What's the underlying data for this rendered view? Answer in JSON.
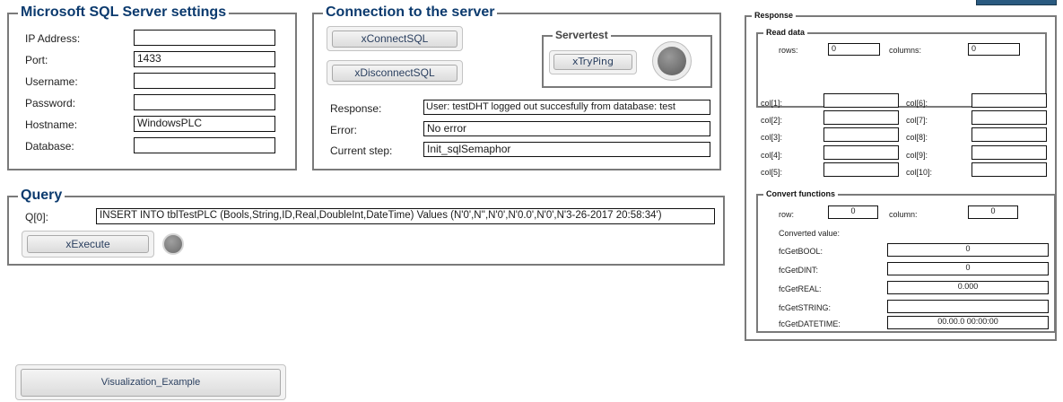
{
  "sql_settings": {
    "title": "Microsoft SQL Server settings",
    "fields": [
      {
        "label": "IP Address:",
        "value": ""
      },
      {
        "label": "Port:",
        "value": "1433"
      },
      {
        "label": "Username:",
        "value": ""
      },
      {
        "label": "Password:",
        "value": ""
      },
      {
        "label": "Hostname:",
        "value": "WindowsPLC"
      },
      {
        "label": "Database:",
        "value": ""
      }
    ]
  },
  "connection": {
    "title": "Connection to the server",
    "connect_label": "xConnectSQL",
    "disconnect_label": "xDisconnectSQL",
    "servertest": {
      "title": "Servertest",
      "ping_label": "xTryPing",
      "lamp_color": "#6e6e6e"
    },
    "response_label": "Response:",
    "response_value": "User: testDHT  logged out succesfully from database: test",
    "error_label": "Error:",
    "error_value": "No error",
    "step_label": "Current step:",
    "step_value": "Init_sqlSemaphor"
  },
  "query": {
    "title": "Query",
    "q_label": "Q[0]:",
    "q_value": "INSERT INTO tblTestPLC (Bools,String,ID,Real,DoubleInt,DateTime) Values (N'0',N'',N'0',N'0.0',N'0',N'3-26-2017 20:58:34')",
    "execute_label": "xExecute",
    "lamp_color": "#7a7a7a"
  },
  "response": {
    "title": "Response",
    "read_data": {
      "title": "Read data",
      "rows_label": "rows:",
      "rows_value": "0",
      "columns_label": "columns:",
      "columns_value": "0"
    },
    "cols_left": [
      {
        "label": "col[1]:",
        "value": ""
      },
      {
        "label": "col[2]:",
        "value": ""
      },
      {
        "label": "col[3]:",
        "value": ""
      },
      {
        "label": "col[4]:",
        "value": ""
      },
      {
        "label": "col[5]:",
        "value": ""
      }
    ],
    "cols_right": [
      {
        "label": "col[6]:",
        "value": ""
      },
      {
        "label": "col[7]:",
        "value": ""
      },
      {
        "label": "col[8]:",
        "value": ""
      },
      {
        "label": "col[9]:",
        "value": ""
      },
      {
        "label": "col[10]:",
        "value": ""
      }
    ],
    "convert": {
      "title": "Convert functions",
      "row_label": "row:",
      "row_value": "0",
      "column_label": "column:",
      "column_value": "0",
      "converted_label": "Converted value:",
      "functions": [
        {
          "label": "fcGetBOOL:",
          "value": "0"
        },
        {
          "label": "fcGetDINT:",
          "value": "0"
        },
        {
          "label": "fcGetREAL:",
          "value": "0.000"
        },
        {
          "label": "fcGetSTRING:",
          "value": ""
        },
        {
          "label": "fcGetDATETIME:",
          "value": "00.00.0 00:00:00"
        }
      ]
    }
  },
  "visualization_button_label": "Visualization_Example",
  "accent_color": "#0b3a6e",
  "top_right_tab_color": "#2a5a80"
}
